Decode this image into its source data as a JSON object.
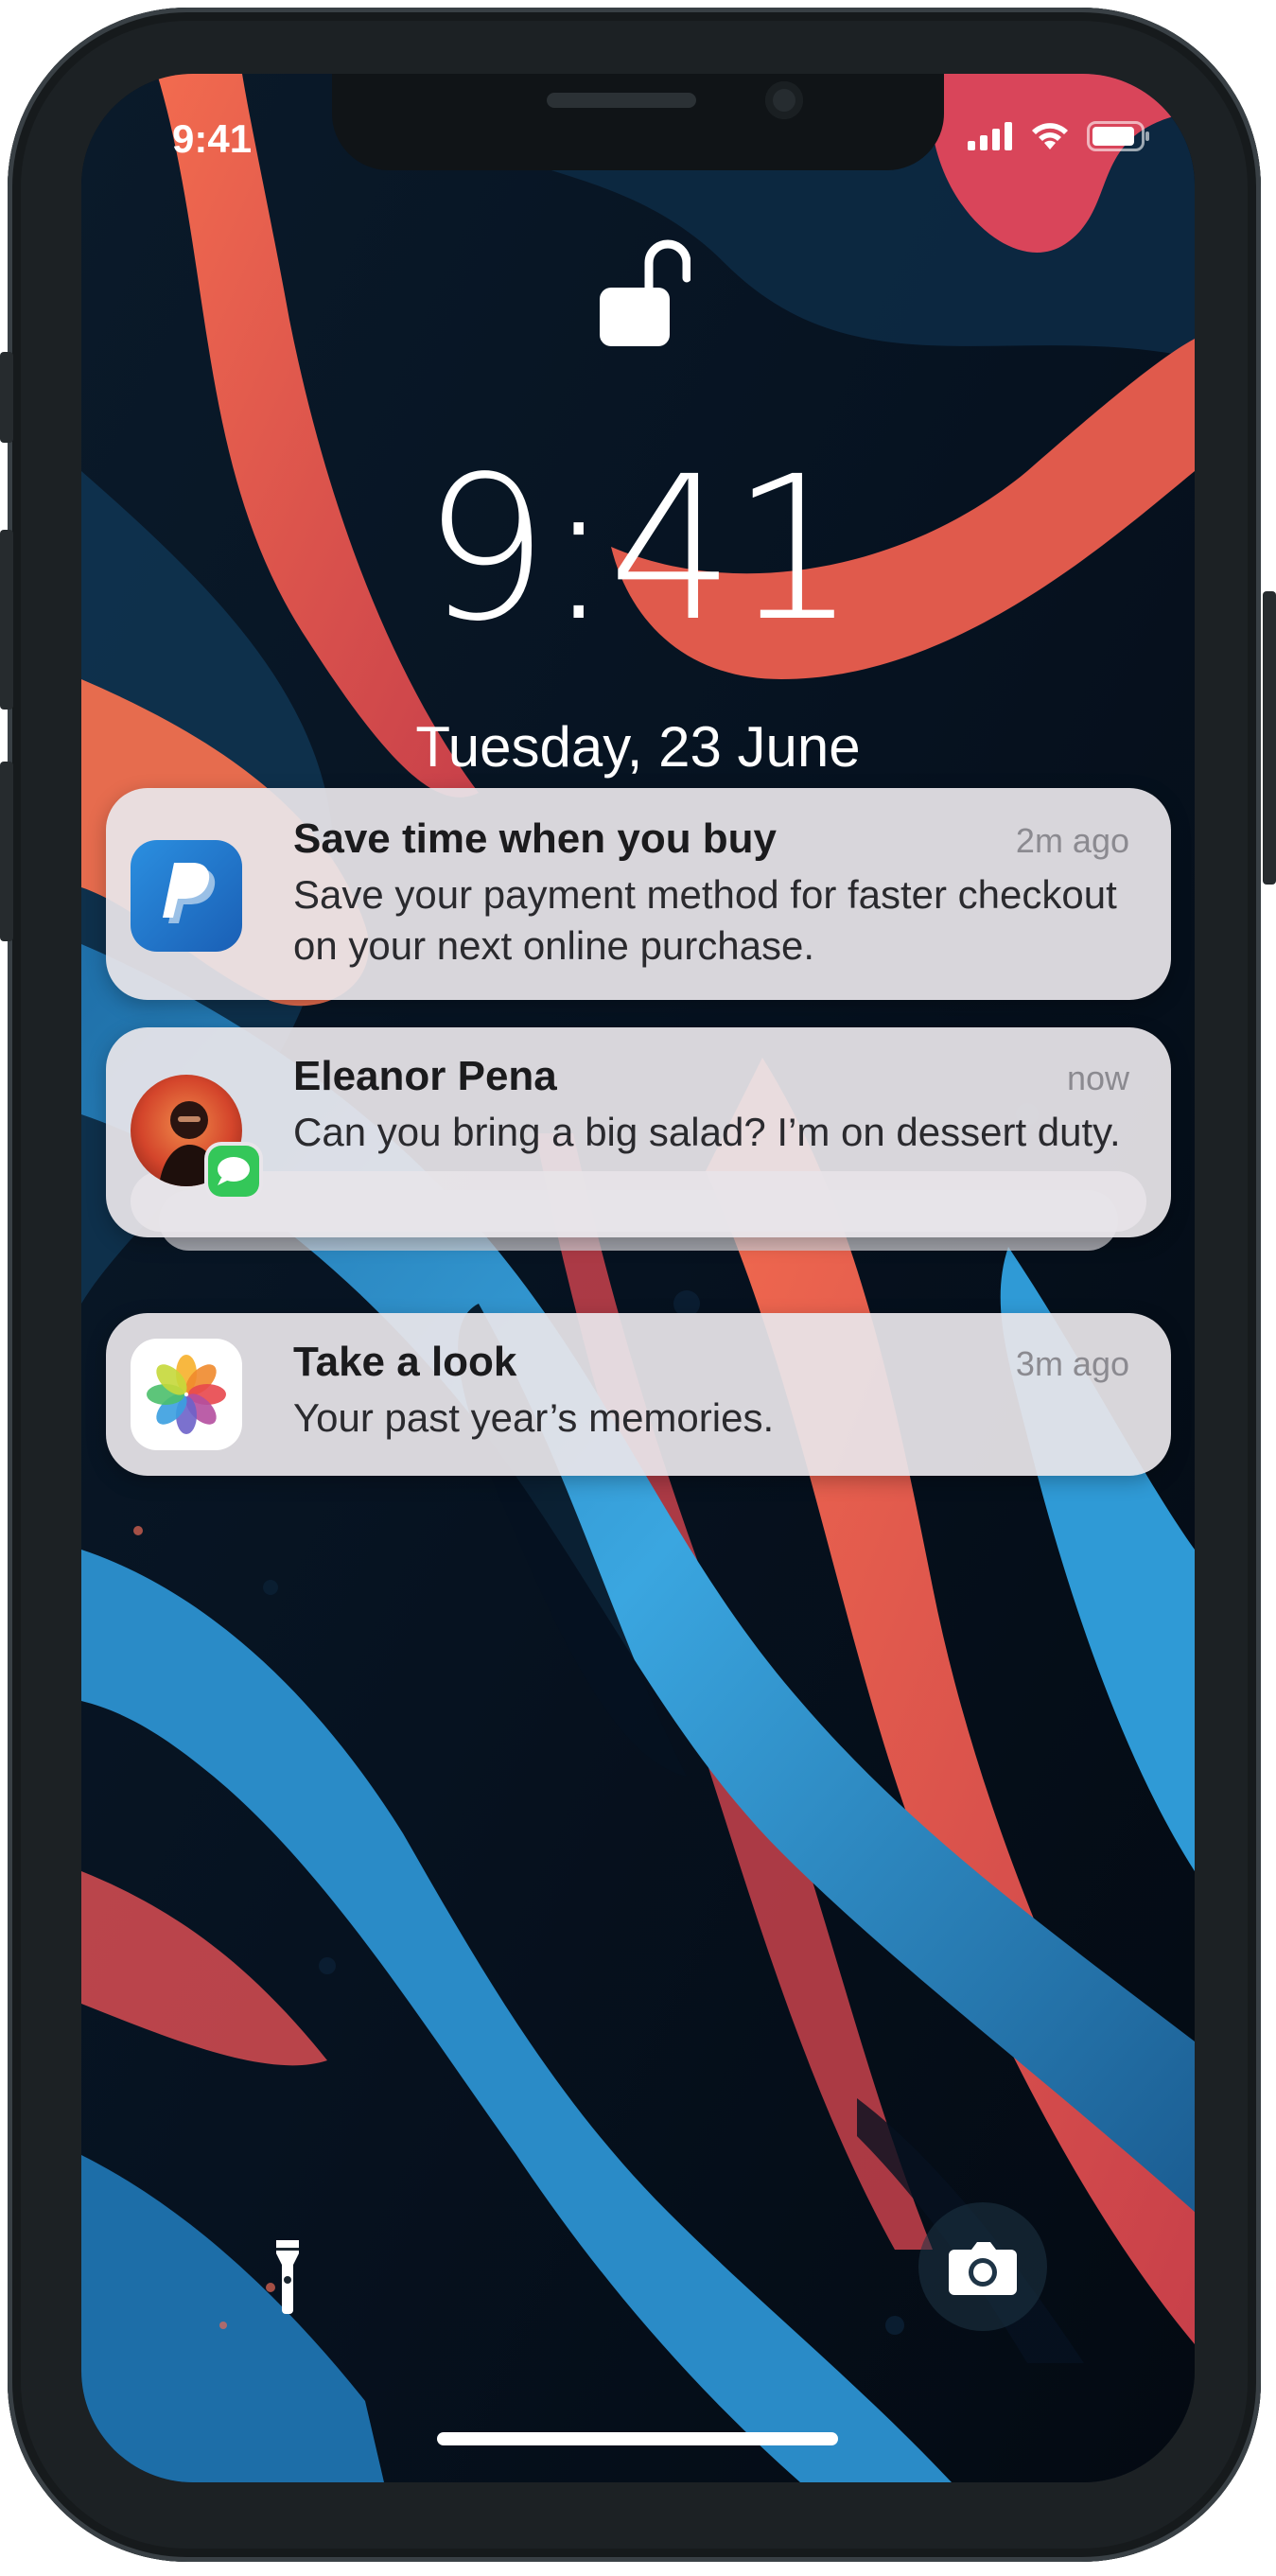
{
  "status_bar": {
    "time": "9:41",
    "signal_icon": "cellular-signal-icon",
    "wifi_icon": "wifi-icon",
    "battery_icon": "battery-icon"
  },
  "lock_screen": {
    "lock_icon": "unlocked-padlock-icon",
    "time": "9:41",
    "date": "Tuesday, 23 June"
  },
  "notifications": [
    {
      "app_icon": "paypal-icon",
      "title": "Save time when you buy",
      "time": "2m ago",
      "body": "Save your payment method for faster checkout on your next online purchase."
    },
    {
      "app_icon": "messages-icon",
      "avatar": "contact-avatar",
      "title": "Eleanor Pena",
      "time": "now",
      "body": "Can you bring a big salad? I’m on dessert duty."
    },
    {
      "app_icon": "photos-icon",
      "title": "Take a look",
      "time": "3m ago",
      "body": "Your past year’s memories."
    }
  ],
  "bottom_controls": {
    "left_icon": "flashlight-icon",
    "right_icon": "camera-icon"
  },
  "colors": {
    "wallpaper_dark": "#05101c",
    "wallpaper_blue": "#2f9ad6",
    "wallpaper_red": "#e8604e",
    "notification_bg": "#e8e5ea",
    "frame": "#1c2124"
  }
}
